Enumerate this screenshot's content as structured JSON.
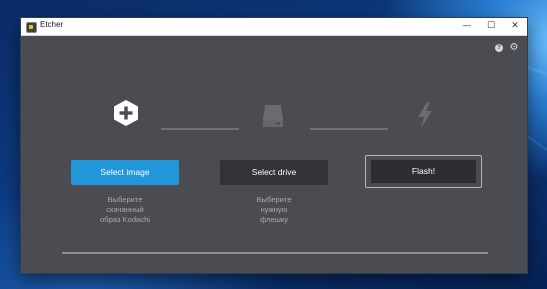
{
  "window": {
    "title": "Etcher",
    "controls": {
      "minimize": "—",
      "maximize": "☐",
      "close": "✕"
    }
  },
  "header_icons": {
    "help": "help-icon",
    "settings": "gear-icon"
  },
  "steps": [
    {
      "icon": "plus-hexagon-icon",
      "button_label": "Select image",
      "text": "Выберите\nскачанный\nобраз Kodachi"
    },
    {
      "icon": "drive-icon",
      "button_label": "Select drive",
      "text": "Выберите\nнужную\nфлешку"
    },
    {
      "icon": "lightning-icon",
      "button_label": "Flash!",
      "text": ""
    }
  ],
  "colors": {
    "accent": "#2196d9",
    "window_bg": "#4b4c51",
    "button_dark": "#323336"
  }
}
